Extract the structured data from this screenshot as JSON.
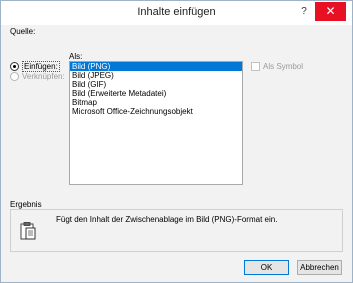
{
  "dialog": {
    "title": "Inhalte einfügen",
    "help": "?",
    "close": "✕"
  },
  "source": {
    "label": "Quelle:",
    "options": {
      "paste": "Einfügen:",
      "link": "Verknüpfen:"
    }
  },
  "as": {
    "label": "Als:",
    "items": [
      "Bild (PNG)",
      "Bild (JPEG)",
      "Bild (GIF)",
      "Bild (Erweiterte Metadatei)",
      "Bitmap",
      "Microsoft Office-Zeichnungsobjekt"
    ],
    "selected_index": 0
  },
  "display_as_icon": {
    "label": "Als Symbol",
    "checked": false
  },
  "result": {
    "label": "Ergebnis",
    "text": "Fügt den Inhalt der Zwischenablage im Bild (PNG)-Format ein."
  },
  "buttons": {
    "ok": "OK",
    "cancel": "Abbrechen"
  }
}
